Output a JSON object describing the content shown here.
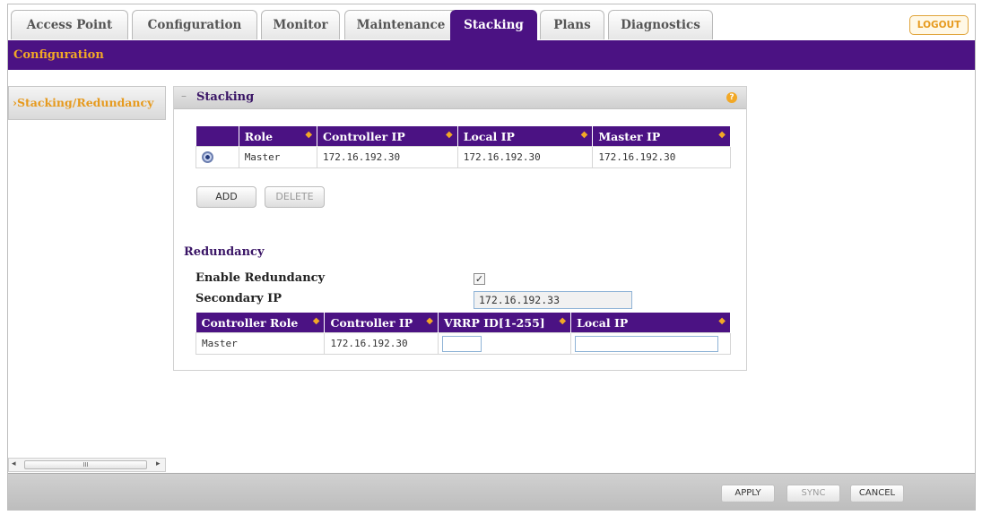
{
  "tabs": [
    {
      "label": "Access Point"
    },
    {
      "label": "Configuration"
    },
    {
      "label": "Monitor"
    },
    {
      "label": "Maintenance"
    },
    {
      "label": "Stacking",
      "active": true
    },
    {
      "label": "Plans"
    },
    {
      "label": "Diagnostics"
    }
  ],
  "logout_label": "LOGOUT",
  "subnav_label": "Configuration",
  "sidebar": {
    "items": [
      {
        "label": "›Stacking/Redundancy"
      }
    ]
  },
  "stacking": {
    "title": "Stacking",
    "help_icon": "?",
    "columns": [
      "Role",
      "Controller IP",
      "Local IP",
      "Master IP"
    ],
    "rows": [
      {
        "selected": true,
        "role": "Master",
        "controller_ip": "172.16.192.30",
        "local_ip": "172.16.192.30",
        "master_ip": "172.16.192.30"
      }
    ],
    "add_label": "ADD",
    "delete_label": "DELETE"
  },
  "redundancy": {
    "title": "Redundancy",
    "enable_label": "Enable Redundancy",
    "enable_checked": true,
    "secondary_label": "Secondary IP",
    "secondary_value": "172.16.192.33",
    "columns": [
      "Controller Role",
      "Controller IP",
      "VRRP ID[1-255]",
      "Local IP"
    ],
    "rows": [
      {
        "controller_role": "Master",
        "controller_ip": "172.16.192.30",
        "vrrp_id": "",
        "local_ip": ""
      }
    ]
  },
  "scrollbar": {
    "thumb_grip": "III"
  },
  "footer": {
    "apply_label": "APPLY",
    "sync_label": "SYNC",
    "cancel_label": "CANCEL"
  },
  "colors": {
    "accent": "#4b1283",
    "highlight": "#f2a826"
  }
}
